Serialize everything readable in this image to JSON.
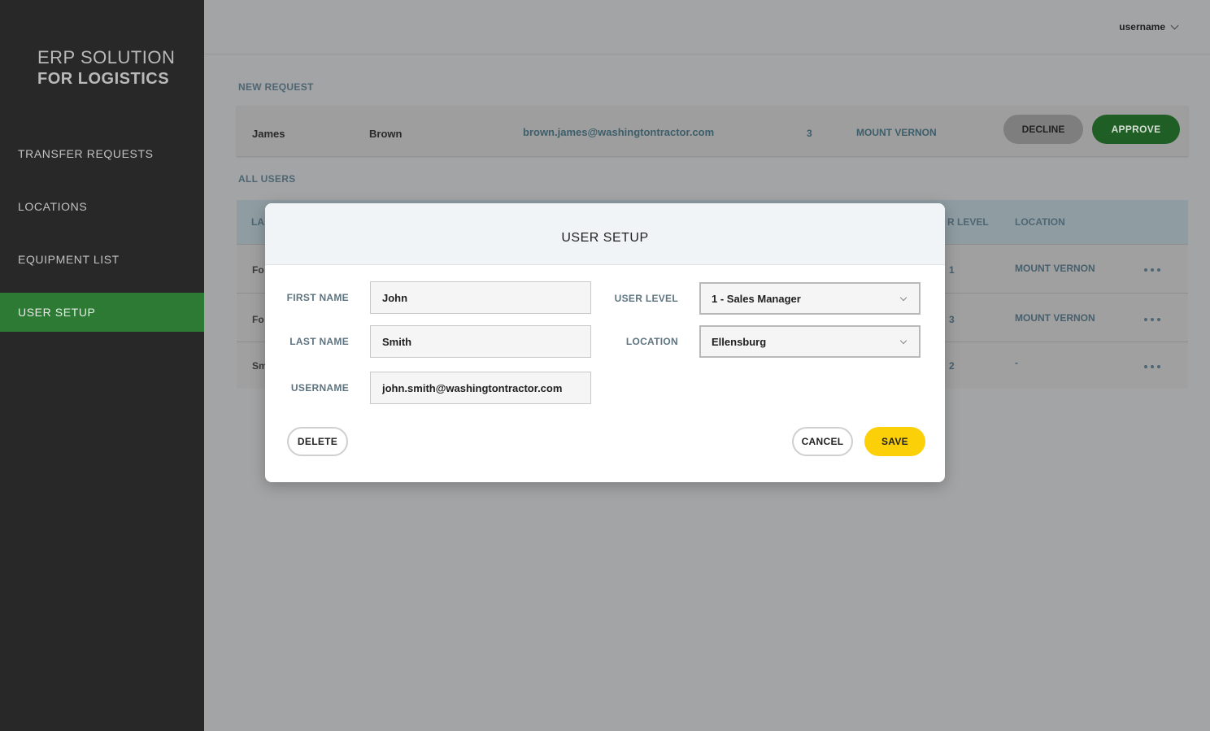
{
  "brand": {
    "line1": "ERP SOLUTION",
    "line2": "FOR LOGISTICS"
  },
  "sidebar": {
    "items": [
      {
        "label": "TRANSFER REQUESTS"
      },
      {
        "label": "LOCATIONS"
      },
      {
        "label": "EQUIPMENT LIST"
      },
      {
        "label": "USER SETUP",
        "active": true
      }
    ]
  },
  "header": {
    "user_label": "username"
  },
  "new_request": {
    "section_label": "NEW REQUEST",
    "first_name": "James",
    "last_name": "Brown",
    "email": "brown.james@washingtontractor.com",
    "level": "3",
    "location": "MOUNT VERNON",
    "decline_label": "DECLINE",
    "approve_label": "APPROVE"
  },
  "all_users": {
    "section_label": "ALL USERS",
    "headers": {
      "last_name": "LA",
      "user_level": "R LEVEL",
      "location": "LOCATION"
    },
    "rows": [
      {
        "last_name": "Fo",
        "level": "1",
        "location": "MOUNT VERNON"
      },
      {
        "last_name": "Fo",
        "level": "3",
        "location": "MOUNT VERNON"
      },
      {
        "last_name": "Sm",
        "level": "2",
        "location": "-"
      }
    ]
  },
  "modal": {
    "title": "USER SETUP",
    "first_name_label": "FIRST NAME",
    "first_name_value": "John",
    "last_name_label": "LAST NAME",
    "last_name_value": "Smith",
    "username_label": "USERNAME",
    "username_value": "john.smith@washingtontractor.com",
    "user_level_label": "USER LEVEL",
    "user_level_value": "1 - Sales Manager",
    "location_label": "LOCATION",
    "location_value": "Ellensburg",
    "delete_label": "DELETE",
    "cancel_label": "CANCEL",
    "save_label": "SAVE"
  },
  "colors": {
    "sidebar_bg": "#282828",
    "active_nav": "#2c7a33",
    "approve": "#1f5e25",
    "save": "#fcd009",
    "overlay_bg": "#a3a4a5"
  }
}
